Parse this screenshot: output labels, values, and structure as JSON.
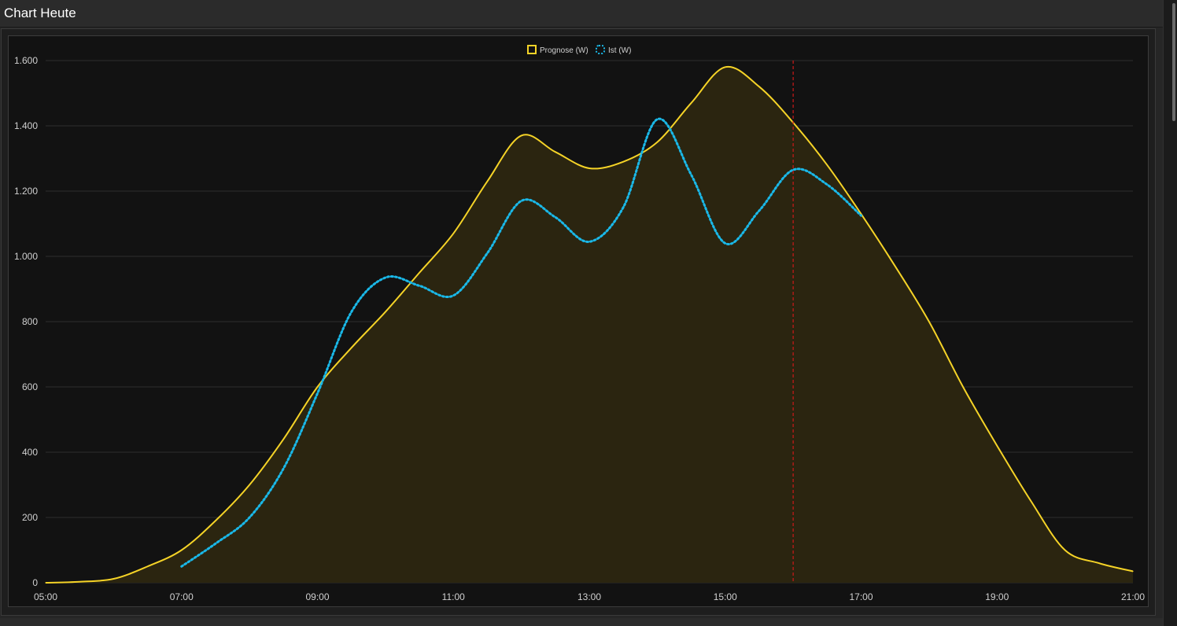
{
  "page": {
    "title": "Chart Heute"
  },
  "colors": {
    "forecast": "#f5d327",
    "forecast_fill": "#2b2510",
    "actual": "#1ab8e8",
    "now_line": "#cc1a1a",
    "grid": "#2e2e2e",
    "text": "#d0d0d0"
  },
  "chart_data": {
    "type": "area",
    "x_ticks": [
      "05:00",
      "07:00",
      "09:00",
      "11:00",
      "13:00",
      "15:00",
      "17:00",
      "19:00",
      "21:00"
    ],
    "y_ticks": [
      0,
      200,
      400,
      600,
      800,
      1000,
      1200,
      1400,
      1600
    ],
    "y_tick_labels": [
      "0",
      "200",
      "400",
      "600",
      "800",
      "1.000",
      "1.200",
      "1.400",
      "1.600"
    ],
    "xlim": [
      "05:00",
      "21:00"
    ],
    "ylim": [
      0,
      1600
    ],
    "grid": true,
    "legend_position": "top-center",
    "now_marker": "16:00",
    "series": [
      {
        "name": "Prognose (W)",
        "style": "solid-area",
        "points": [
          [
            "05:00",
            0
          ],
          [
            "05:30",
            3
          ],
          [
            "06:00",
            12
          ],
          [
            "06:30",
            50
          ],
          [
            "07:00",
            100
          ],
          [
            "07:30",
            190
          ],
          [
            "08:00",
            300
          ],
          [
            "08:30",
            440
          ],
          [
            "09:00",
            600
          ],
          [
            "09:30",
            720
          ],
          [
            "10:00",
            830
          ],
          [
            "10:30",
            950
          ],
          [
            "11:00",
            1070
          ],
          [
            "11:30",
            1230
          ],
          [
            "12:00",
            1370
          ],
          [
            "12:30",
            1320
          ],
          [
            "13:00",
            1270
          ],
          [
            "13:30",
            1290
          ],
          [
            "14:00",
            1350
          ],
          [
            "14:30",
            1470
          ],
          [
            "15:00",
            1580
          ],
          [
            "15:30",
            1520
          ],
          [
            "16:00",
            1410
          ],
          [
            "16:30",
            1280
          ],
          [
            "17:00",
            1130
          ],
          [
            "17:30",
            970
          ],
          [
            "18:00",
            800
          ],
          [
            "18:30",
            600
          ],
          [
            "19:00",
            420
          ],
          [
            "19:30",
            250
          ],
          [
            "20:00",
            100
          ],
          [
            "20:30",
            60
          ],
          [
            "21:00",
            35
          ]
        ]
      },
      {
        "name": "Ist (W)",
        "style": "dotted-line",
        "points": [
          [
            "07:00",
            50
          ],
          [
            "07:30",
            120
          ],
          [
            "08:00",
            200
          ],
          [
            "08:30",
            350
          ],
          [
            "09:00",
            580
          ],
          [
            "09:30",
            830
          ],
          [
            "10:00",
            935
          ],
          [
            "10:30",
            910
          ],
          [
            "11:00",
            880
          ],
          [
            "11:30",
            1010
          ],
          [
            "12:00",
            1170
          ],
          [
            "12:30",
            1120
          ],
          [
            "13:00",
            1045
          ],
          [
            "13:30",
            1150
          ],
          [
            "14:00",
            1420
          ],
          [
            "14:30",
            1250
          ],
          [
            "15:00",
            1040
          ],
          [
            "15:30",
            1140
          ],
          [
            "16:00",
            1265
          ],
          [
            "16:30",
            1220
          ],
          [
            "17:00",
            1125
          ]
        ]
      }
    ]
  }
}
